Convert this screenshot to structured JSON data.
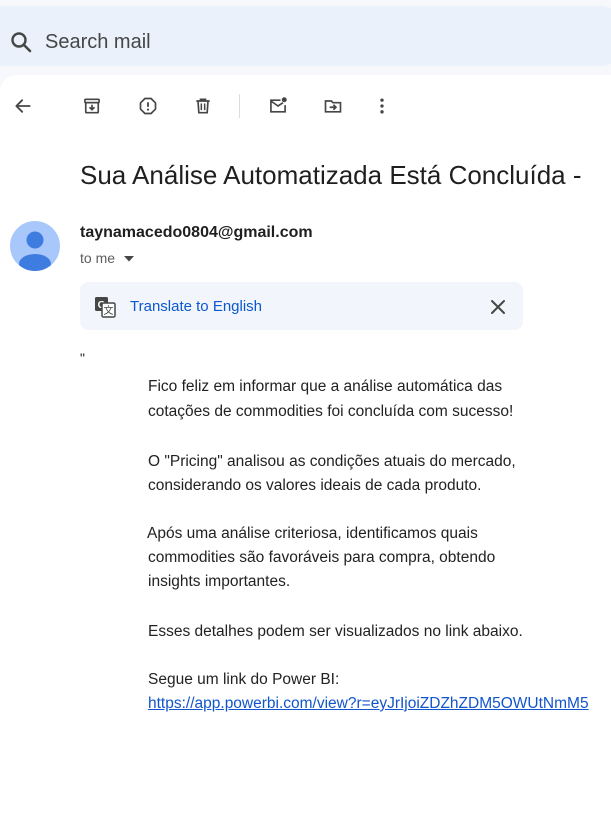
{
  "search": {
    "placeholder": "Search mail"
  },
  "toolbar": {
    "icons": [
      "back-arrow-icon",
      "archive-icon",
      "report-spam-icon",
      "delete-icon",
      "mark-unread-icon",
      "move-to-icon",
      "more-options-icon"
    ]
  },
  "email": {
    "subject": "Sua Análise Automatizada Está Concluída -",
    "sender": "taynamacedo0804@gmail.com",
    "recipient": "to me",
    "translate_label": "Translate to English",
    "quote_mark": "\"",
    "body": {
      "line1": "Fico feliz em informar que a análise automática das",
      "line2": "cotações de commodities foi concluída com sucesso!",
      "line3": "O \"Pricing\" analisou as condições atuais do mercado,",
      "line4": "considerando os valores ideais de cada produto.",
      "line5": "Após uma análise criteriosa, identificamos quais",
      "line6": "commodities são favoráveis para compra, obtendo",
      "line7": "insights importantes.",
      "line8": "Esses detalhes podem ser visualizados no link abaixo.",
      "line9": "Segue um link do Power BI:",
      "link": "https://app.powerbi.com/view?r=eyJrIjoiZDZhZDM5OWUtNmM5"
    }
  },
  "colors": {
    "page_bg": "#f6f8fc",
    "search_bg": "#eaf1fb",
    "avatar_bg": "#a8c7fa",
    "avatar_fg": "#3f7ce0",
    "link": "#1155cc",
    "translate_link": "#0b57d0"
  }
}
